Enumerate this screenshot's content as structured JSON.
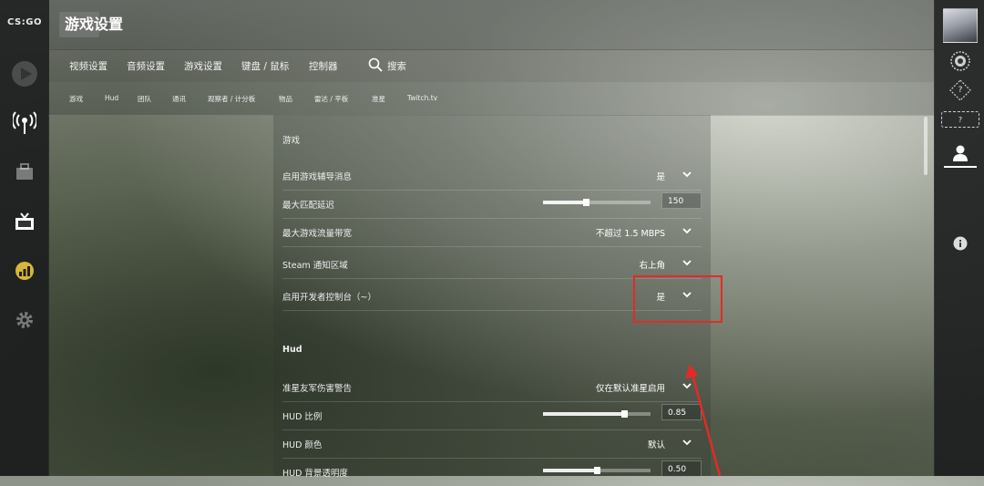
{
  "app": {
    "logo_text": "CS:GO"
  },
  "header": {
    "title": "游戏设置"
  },
  "tabs": [
    {
      "label": "视频设置"
    },
    {
      "label": "音频设置"
    },
    {
      "label": "游戏设置"
    },
    {
      "label": "键盘 / 鼠标"
    },
    {
      "label": "控制器"
    }
  ],
  "search": {
    "label": "搜索",
    "icon": "search-icon"
  },
  "subtabs": [
    {
      "label": "游戏"
    },
    {
      "label": "Hud"
    },
    {
      "label": "团队"
    },
    {
      "label": "通讯"
    },
    {
      "label": "观察者 / 计分板"
    },
    {
      "label": "物品"
    },
    {
      "label": "雷达 / 平板"
    },
    {
      "label": "准星"
    },
    {
      "label": "Twitch.tv"
    }
  ],
  "left_sidebar": {
    "icons": [
      "play-icon",
      "broadcast-icon",
      "inventory-icon",
      "tv-icon",
      "stats-icon",
      "gear-icon"
    ]
  },
  "right_sidebar": {
    "icons": [
      "avatar",
      "rank-icon",
      "unknown-rank-icon",
      "unknown-rank-icon",
      "friends-icon",
      "info-icon"
    ],
    "question_mark": "?"
  },
  "sections": {
    "game": {
      "title": "游戏",
      "rows": [
        {
          "label": "启用游戏辅导消息",
          "value": "是",
          "type": "dropdown"
        },
        {
          "label": "最大匹配延迟",
          "value": "150",
          "type": "slider",
          "level": 0.4
        },
        {
          "label": "最大游戏流量带宽",
          "value": "不超过 1.5 MBPS",
          "type": "dropdown"
        },
        {
          "label": "Steam 通知区域",
          "value": "右上角",
          "type": "dropdown"
        },
        {
          "label": "启用开发者控制台（~）",
          "value": "是",
          "type": "dropdown"
        }
      ]
    },
    "hud": {
      "title": "Hud",
      "rows": [
        {
          "label": "准星友军伤害警告",
          "value": "仅在默认准星启用",
          "type": "dropdown"
        },
        {
          "label": "HUD 比例",
          "value": "0.85",
          "type": "slider",
          "level": 0.75
        },
        {
          "label": "HUD 颜色",
          "value": "默认",
          "type": "dropdown"
        },
        {
          "label": "HUD 背景透明度",
          "value": "0.50",
          "type": "slider",
          "level": 0.5
        }
      ]
    }
  },
  "colors": {
    "annotation": "#e52a24",
    "accent": "#ffffff"
  }
}
